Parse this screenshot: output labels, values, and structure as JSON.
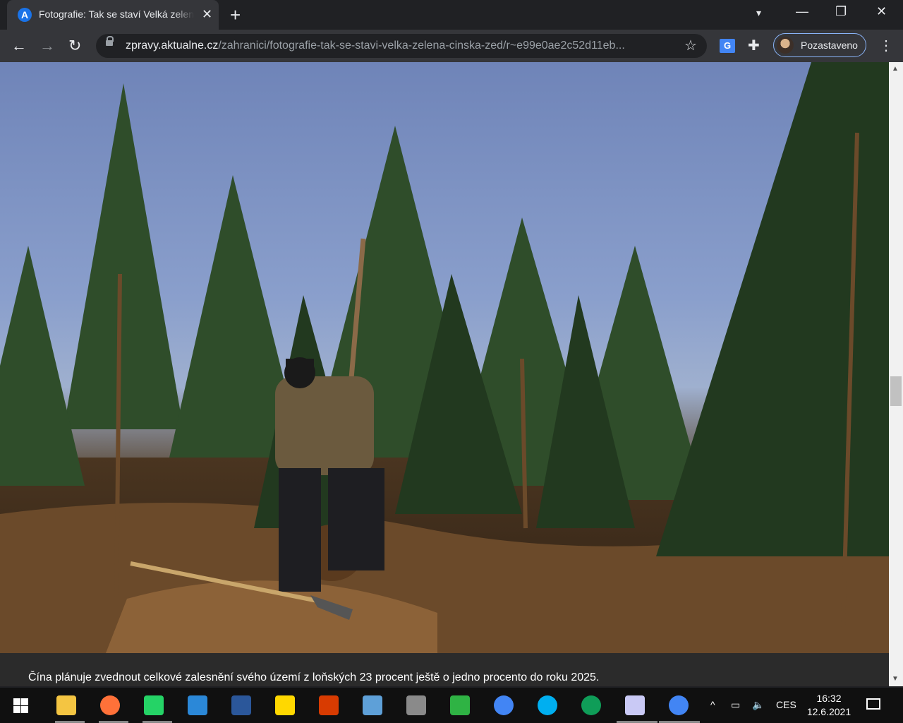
{
  "browser": {
    "tab": {
      "favicon_letter": "A",
      "title": "Fotografie: Tak se staví Velká zelená čínská zeď",
      "close_glyph": "✕"
    },
    "new_tab_glyph": "+",
    "window_controls": {
      "minimize": "—",
      "restore": "❐",
      "close": "✕"
    },
    "nav": {
      "back": "←",
      "forward": "→",
      "reload": "↻"
    },
    "address": {
      "host": "zpravy.aktualne.cz",
      "path": "/zahranici/fotografie-tak-se-stavi-velka-zelena-cinska-zed/r~e99e0ae2c52d11eb...",
      "star_glyph": "☆"
    },
    "extensions": {
      "translate": "G",
      "puzzle": "✚"
    },
    "profile": {
      "label": "Pozastaveno"
    },
    "menu": "⋮"
  },
  "page": {
    "caption": "Čína plánuje zvednout celkové zalesnění svého území z loňských 23 procent ještě o jedno procento do roku 2025."
  },
  "scrollbar": {
    "up": "▲",
    "down": "▼",
    "position": 0.55
  },
  "taskbar": {
    "apps": [
      {
        "name": "file-explorer",
        "color": "#f4c542"
      },
      {
        "name": "firefox",
        "color": "#ff7139"
      },
      {
        "name": "messages",
        "color": "#25d366"
      },
      {
        "name": "phone-app",
        "color": "#2b88d8"
      },
      {
        "name": "word",
        "color": "#2b579a"
      },
      {
        "name": "sticky-notes",
        "color": "#ffd800"
      },
      {
        "name": "office",
        "color": "#d83b01"
      },
      {
        "name": "settings-app",
        "color": "#5ea0d8"
      },
      {
        "name": "calculator",
        "color": "#8a8a8a"
      },
      {
        "name": "resource-monitor",
        "color": "#2fb344"
      },
      {
        "name": "chrome",
        "color": "#4285f4"
      },
      {
        "name": "skype",
        "color": "#00aff0"
      },
      {
        "name": "edge",
        "color": "#0f9d58"
      },
      {
        "name": "paint",
        "color": "#c9c9f5"
      },
      {
        "name": "chrome-active",
        "color": "#4285f4"
      }
    ],
    "tray": {
      "chevron": "^",
      "network": "▭",
      "volume": "🔈",
      "language": "CES"
    },
    "clock": {
      "time": "16:32",
      "date": "12.6.2021"
    }
  }
}
